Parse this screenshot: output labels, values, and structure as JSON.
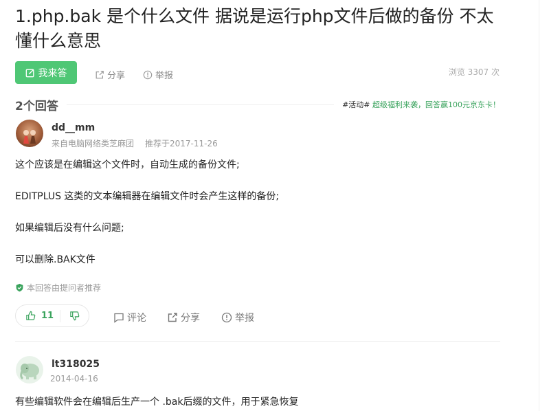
{
  "question": {
    "title": "1.php.bak 是个什么文件 据说是运行php文件后做的备份 不太懂什么意思",
    "answer_button": "我来答",
    "share": "分享",
    "report": "举报",
    "views": "浏览 3307 次"
  },
  "answers_header": {
    "count": "2个回答",
    "activity_tag": "#活动#",
    "activity_text": " 超级福利来袭，回答赢100元京东卡！"
  },
  "answer1": {
    "user": "dd__mm",
    "source": "来自电脑网络类芝麻团",
    "date": "推荐于2017-11-26",
    "lines": [
      "这个应该是在编辑这个文件时，自动生成的备份文件;",
      "EDITPLUS 这类的文本编辑器在编辑文件时会产生这样的备份;",
      "如果编辑后没有什么问题;",
      "可以删除.BAK文件"
    ],
    "recommend": "本回答由提问者推荐",
    "likes": "11",
    "comment": "评论",
    "share": "分享",
    "report": "举报"
  },
  "answer2": {
    "user": "lt318025",
    "date": "2014-04-16",
    "text": "有些编辑软件会在编辑后生产一个 .bak后缀的文件，用于紧急恢复"
  },
  "colors": {
    "accent": "#4fc775",
    "activity": "#3aa35d"
  }
}
